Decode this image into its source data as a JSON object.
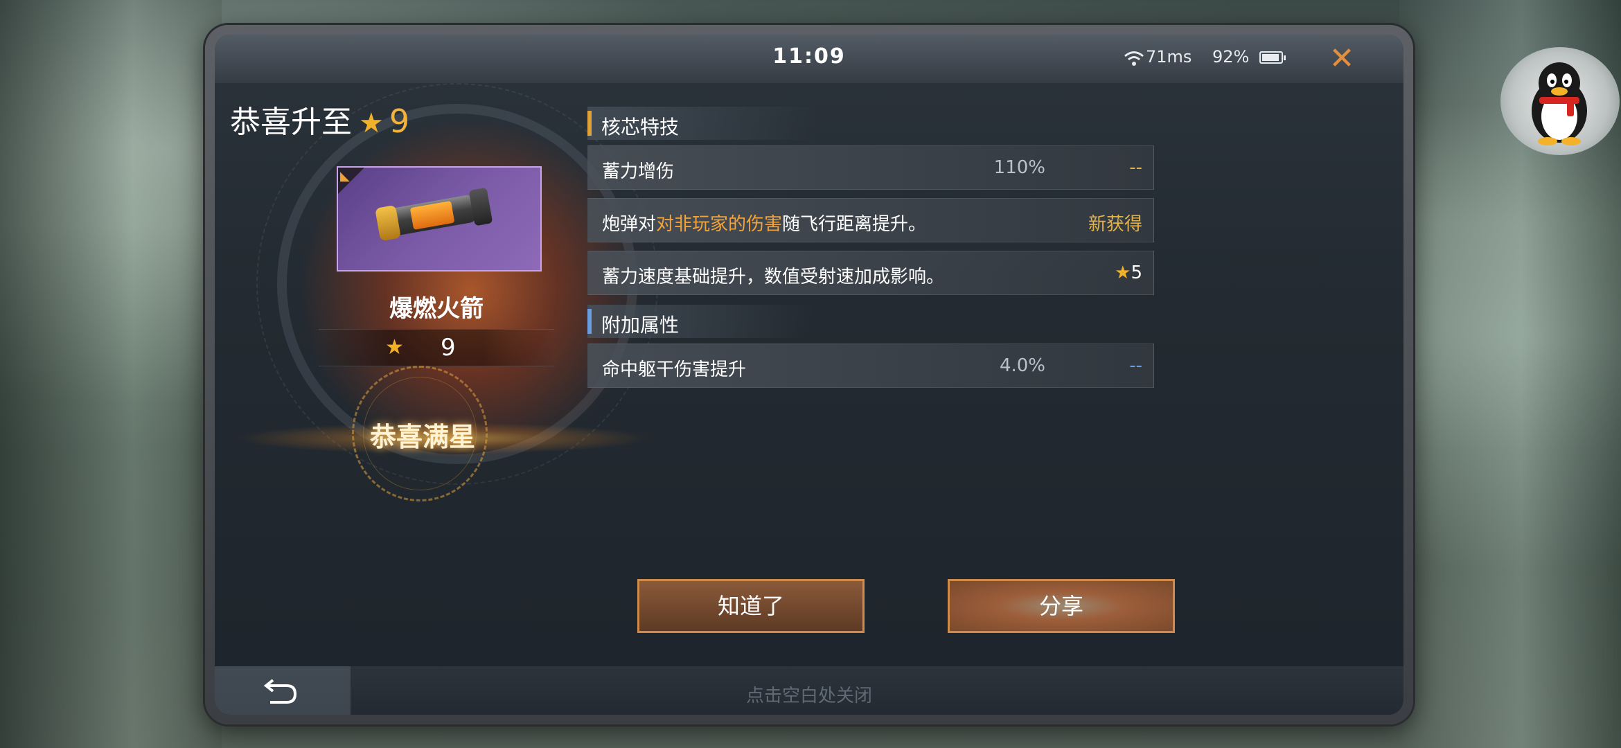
{
  "status_bar": {
    "time": "11:09",
    "ping": "71ms",
    "battery": "92%",
    "battery_level": 0.92
  },
  "dialog": {
    "congrats_title": "恭喜升至",
    "congrats_level": "9",
    "weapon_name": "爆燃火箭",
    "weapon_stars": "9",
    "max_star_label": "恭喜满星",
    "core_section_title": "核芯特技",
    "core_rows": [
      {
        "label": "蓄力增伤",
        "value": "110%",
        "extra": "--"
      },
      {
        "label_pre": "炮弹对",
        "label_hl": "对非玩家的伤害",
        "label_post": "随飞行距离提升。",
        "extra": "新获得"
      },
      {
        "label": "蓄力速度基础提升，数值受射速加成影响。",
        "extra": "5"
      }
    ],
    "extra_section_title": "附加属性",
    "extra_rows": [
      {
        "label": "命中躯干伤害提升",
        "value": "4.0%",
        "extra": "--"
      }
    ],
    "ack_button": "知道了",
    "share_button": "分享",
    "close_hint": "点击空白处关闭"
  },
  "colors": {
    "accent_gold": "#f1b229",
    "highlight_orange": "#f3a33c",
    "button_border": "#d08b4a",
    "core_bar": "#e2a23a",
    "extra_bar": "#6a9ee0"
  }
}
